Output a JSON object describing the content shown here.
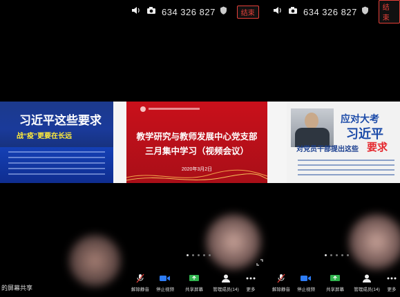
{
  "topbar": {
    "meeting_id": "634 326 827",
    "end_label": "结束"
  },
  "slides": {
    "left": {
      "title": "习近平这些要求",
      "subtitle": "战“疫”更要在长远"
    },
    "center": {
      "line1": "教学研究与教师发展中心党支部",
      "line2": "三月集中学习（视频会议）",
      "date": "2020年3月2日"
    },
    "right": {
      "t1": "应对大考",
      "t2": "习近平",
      "t3": "对党员干部提出这些",
      "t4": "要求"
    }
  },
  "share_label": "的屏幕共享",
  "toolbar": {
    "unmute": "解除静音",
    "stop_video": "停止视频",
    "share_screen": "共享屏幕",
    "manage_members": "管理成员(14)",
    "more": "更多"
  },
  "colors": {
    "end_red": "#e8413a",
    "slide_red": "#c9101b",
    "slide_blue": "#1d3f8e"
  }
}
